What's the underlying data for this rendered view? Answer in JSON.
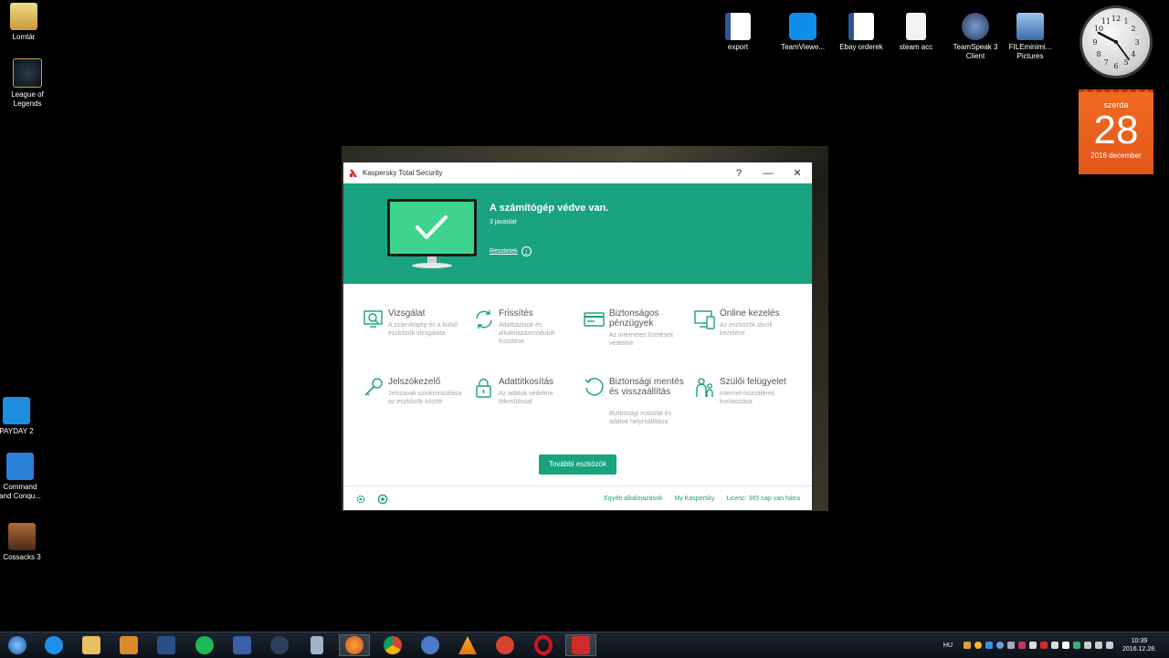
{
  "desktop": {
    "icons_left": [
      {
        "label": "Lomtár",
        "icon": "recycle-bin-icon",
        "color": "#e8c46a"
      },
      {
        "label": "League of\nLegends",
        "icon": "league-icon",
        "color": "#c9a24a"
      },
      {
        "label": "PAYDAY 2",
        "icon": "payday-icon",
        "color": "#1e8fe0"
      },
      {
        "label": "Command\nand Conqu...",
        "icon": "cnc-icon",
        "color": "#2a7fd6"
      },
      {
        "label": "Cossacks 3",
        "icon": "cossacks-icon",
        "color": "#8b4a2a"
      }
    ],
    "icons_top": [
      {
        "label": "export",
        "icon": "word-doc-icon",
        "color": "#2b5797"
      },
      {
        "label": "TeamViewe...",
        "icon": "teamviewer-icon",
        "color": "#0e8ee9"
      },
      {
        "label": "Ebay orderek",
        "icon": "word-doc-icon",
        "color": "#2b5797"
      },
      {
        "label": "steam acc",
        "icon": "text-file-icon",
        "color": "#e6e6e6"
      },
      {
        "label": "TeamSpeak 3\nClient",
        "icon": "teamspeak-icon",
        "color": "#3a5b86"
      },
      {
        "label": "FILEminimi...\nPictures",
        "icon": "fileminimizer-icon",
        "color": "#4a86c8"
      }
    ]
  },
  "calendar": {
    "day": "szerda",
    "date": "28",
    "month": "2016 december"
  },
  "window": {
    "title": "Kaspersky Total Security",
    "help": "?",
    "minimize": "—",
    "close": "✕",
    "status_title": "A számítógép védve van.",
    "status_sub": "3 javaslat",
    "details_link": "Részletek",
    "accent": "#1aa37f",
    "tools": [
      {
        "name": "Vizsgálat",
        "desc": "A számítógép és a külső eszközök vizsgálata",
        "icon": "scan-icon"
      },
      {
        "name": "Frissítés",
        "desc": "Adatbázisok és alkalmazásmodulok frissítése",
        "icon": "update-icon"
      },
      {
        "name": "Biztonságos pénzügyek",
        "desc": "Az internetes fizetések védelme",
        "icon": "safe-money-icon"
      },
      {
        "name": "Online kezelés",
        "desc": "Az eszközök távoli kezelése",
        "icon": "online-management-icon"
      },
      {
        "name": "Jelszókezelő",
        "desc": "Jelszavak szinkronizálása az eszközök között",
        "icon": "password-manager-icon"
      },
      {
        "name": "Adattitkosítás",
        "desc": "Az adatok védelme titkosítással",
        "icon": "encryption-icon"
      },
      {
        "name": "Biztonsági mentés és visszaállítás",
        "desc": "Biztonsági másolat és adatok helyreállítása",
        "icon": "backup-icon"
      },
      {
        "name": "Szülői felügyelet",
        "desc": "Internet-hozzáférés korlátozása",
        "icon": "parental-control-icon"
      }
    ],
    "more_tools": "További eszközök",
    "footer_links": [
      "Egyéb alkalmazások",
      "My Kaspersky",
      "Licenc: 365 nap van hátra"
    ]
  },
  "taskbar": {
    "items": [
      {
        "icon": "start-icon",
        "color": "#2d7fd1"
      },
      {
        "icon": "ie-icon",
        "color": "#1e90e8"
      },
      {
        "icon": "explorer-icon",
        "color": "#e6c061"
      },
      {
        "icon": "media-player-icon",
        "color": "#d98a2a"
      },
      {
        "icon": "app-icon",
        "color": "#2a4f86"
      },
      {
        "icon": "spotify-icon",
        "color": "#1db954"
      },
      {
        "icon": "save-icon",
        "color": "#3a5fa8"
      },
      {
        "icon": "steam-icon",
        "color": "#2a3f5a"
      },
      {
        "icon": "calculator-icon",
        "color": "#9fb3c8"
      },
      {
        "icon": "firefox-icon",
        "color": "#e66a1f"
      },
      {
        "icon": "chrome-icon",
        "color": "#4a8fe0"
      },
      {
        "icon": "qbittorrent-icon",
        "color": "#4a7ac8"
      },
      {
        "icon": "vlc-icon",
        "color": "#f08a00"
      },
      {
        "icon": "ccleaner-icon",
        "color": "#d84030"
      },
      {
        "icon": "opera-icon",
        "color": "#d0141f"
      },
      {
        "icon": "kaspersky-icon",
        "color": "#d22a2a"
      }
    ],
    "lang": "HU",
    "time": "10:39",
    "date": "2016.12.28."
  }
}
